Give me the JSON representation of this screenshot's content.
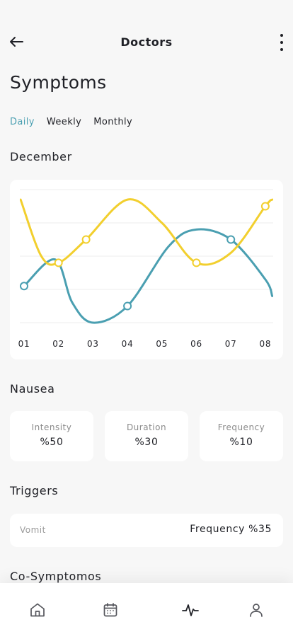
{
  "header": {
    "title": "Doctors",
    "back_icon": "arrow-left-icon",
    "menu_icon": "more-vertical-icon"
  },
  "page_title": "Symptoms",
  "tabs": [
    {
      "label": "Daily",
      "active": true
    },
    {
      "label": "Weekly",
      "active": false
    },
    {
      "label": "Monthly",
      "active": false
    }
  ],
  "month_title": "December",
  "colors": {
    "accent": "#4a9fb1",
    "teal_series": "#4a9fb1",
    "yellow_series": "#f2cf2e"
  },
  "chart_data": {
    "type": "line",
    "title": "",
    "xlabel": "",
    "ylabel": "",
    "categories": [
      "01",
      "02",
      "03",
      "04",
      "05",
      "06",
      "07",
      "08"
    ],
    "ylim": [
      0,
      4
    ],
    "grid": true,
    "series": [
      {
        "color": "#4a9fb1",
        "x": [
          0.0,
          0.9,
          1.4,
          2.0,
          3.0,
          4.2,
          5.0,
          6.0,
          7.0,
          7.2
        ],
        "y": [
          1.1,
          1.9,
          0.6,
          0.0,
          0.5,
          2.3,
          2.8,
          2.5,
          1.3,
          0.8
        ],
        "markers_x": [
          0.0,
          3.0,
          6.0
        ],
        "markers_y": [
          1.1,
          0.5,
          2.5
        ]
      },
      {
        "color": "#f2cf2e",
        "x": [
          -0.1,
          0.5,
          1.0,
          1.8,
          3.0,
          4.0,
          5.0,
          6.0,
          7.0,
          7.2
        ],
        "y": [
          3.7,
          2.0,
          1.8,
          2.5,
          3.7,
          3.0,
          1.8,
          2.1,
          3.5,
          3.7
        ],
        "markers_x": [
          1.0,
          1.8,
          5.0,
          7.0
        ],
        "markers_y": [
          1.8,
          2.5,
          1.8,
          3.5
        ]
      }
    ]
  },
  "nausea": {
    "title": "Nausea",
    "stats": [
      {
        "label": "Intensity",
        "value": "%50"
      },
      {
        "label": "Duration",
        "value": "%30"
      },
      {
        "label": "Frequency",
        "value": "%10"
      }
    ]
  },
  "triggers": {
    "title": "Triggers",
    "item": {
      "name": "Vomit",
      "value": "Frequency %35"
    }
  },
  "co_symptoms_title": "Co-Symptomos",
  "bottom_nav": [
    {
      "icon": "home-icon",
      "active": false
    },
    {
      "icon": "calendar-icon",
      "active": false
    },
    {
      "icon": "activity-icon",
      "active": true
    },
    {
      "icon": "user-icon",
      "active": false
    }
  ]
}
